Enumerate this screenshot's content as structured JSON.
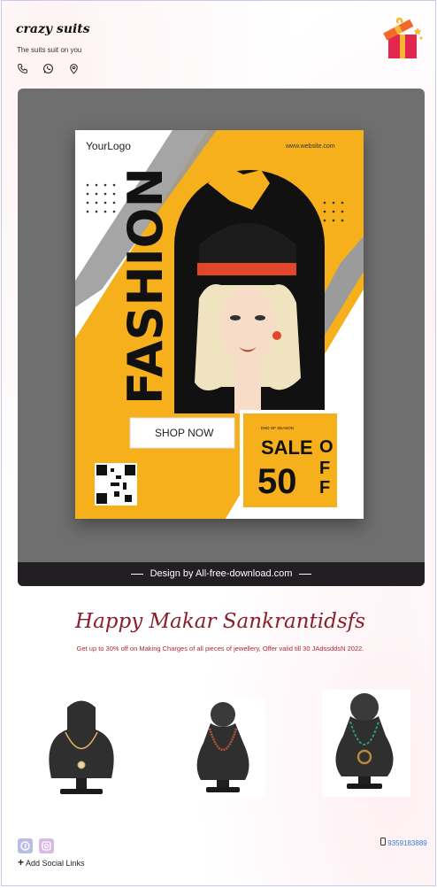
{
  "header": {
    "brand": "crazy suits",
    "tagline": "The suits suit on you",
    "icons": [
      "phone-icon",
      "whatsapp-icon",
      "location-icon"
    ],
    "gift_icon": "gift-icon"
  },
  "poster": {
    "logo": "YourLogo",
    "website": "www.website.com",
    "headline": "FASHION",
    "cta": "SHOP NOW",
    "sale_small": "END OF SEASON",
    "sale_word": "SALE",
    "sale_number": "50",
    "sale_o": "O",
    "sale_f1": "F",
    "sale_f2": "F",
    "credit": "Design by All-free-download.com",
    "colors": {
      "accent": "#f5b01c",
      "dark": "#111111",
      "backdrop": "#6f6f6f"
    }
  },
  "promo": {
    "title": "Happy Makar Sankrantidsfs",
    "subtitle": "Get up to 30% off on Making Charges of all pieces of jewellery, Offer valid till 30 JAdssddsN 2022."
  },
  "products": [
    {
      "name": "necklace-gold-pendant"
    },
    {
      "name": "necklace-beaded"
    },
    {
      "name": "necklace-green-pendant"
    }
  ],
  "footer": {
    "add_social": "Add Social Links",
    "phone": "9359183889"
  }
}
